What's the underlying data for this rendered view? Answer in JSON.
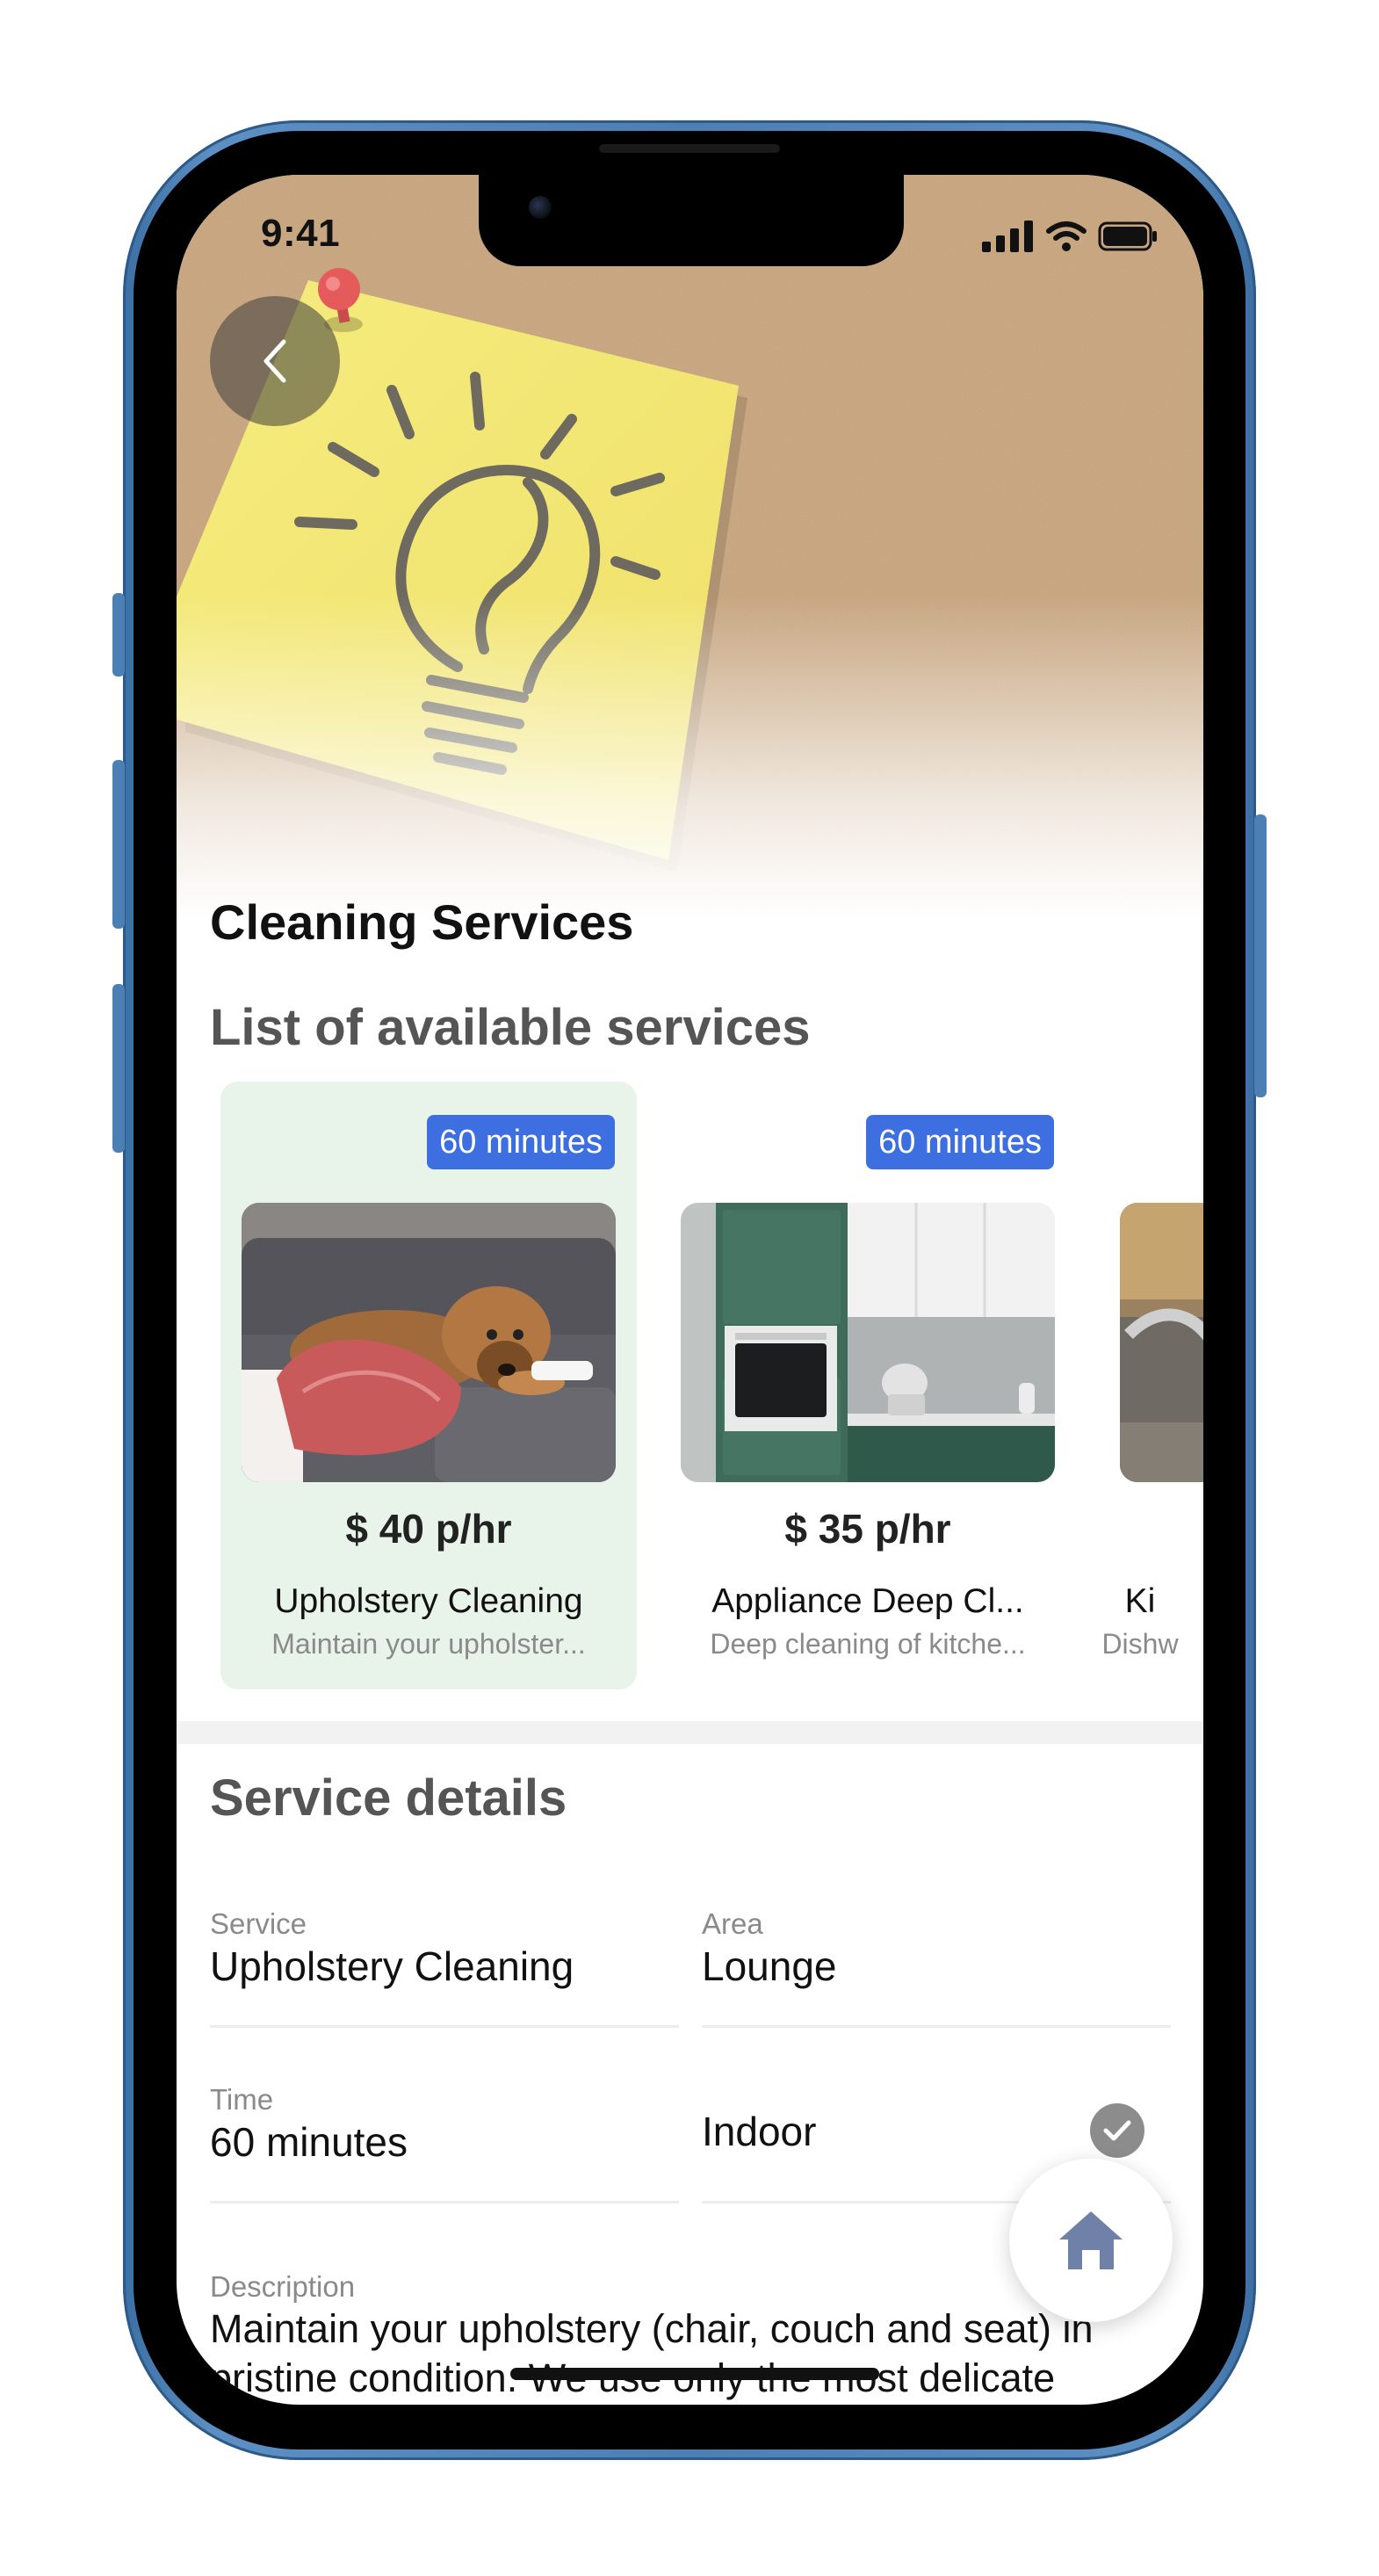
{
  "status_bar": {
    "time": "9:41"
  },
  "header": {
    "title": "Cleaning Services"
  },
  "services_list": {
    "heading": "List of available services",
    "cards": [
      {
        "duration": "60 minutes",
        "price": "$ 40 p/hr",
        "name": "Upholstery Cleaning",
        "description": "Maintain your upholster...",
        "image": "dog-on-sofa",
        "selected": true
      },
      {
        "duration": "60 minutes",
        "price": "$ 35 p/hr",
        "name": "Appliance Deep Cl...",
        "description": "Deep cleaning of kitche...",
        "image": "green-kitchen",
        "selected": false
      },
      {
        "duration": "",
        "price": "",
        "name": "Ki",
        "description": "Dishw",
        "image": "kitchen-sink",
        "selected": false
      }
    ]
  },
  "details": {
    "heading": "Service details",
    "service": {
      "label": "Service",
      "value": "Upholstery Cleaning"
    },
    "area": {
      "label": "Area",
      "value": "Lounge"
    },
    "time": {
      "label": "Time",
      "value": "60 minutes"
    },
    "indoor": {
      "value": "Indoor",
      "checked": true
    },
    "description": {
      "label": "Description",
      "value": "Maintain your upholstery (chair, couch and seat) in pristine condition. We use only the most delicate"
    }
  },
  "colors": {
    "badge": "#3d6fe0",
    "selected_card": "#e8f4ea",
    "frame": "#4c7fb4"
  },
  "icons": {
    "back": "chevron-left-icon",
    "home": "home-icon",
    "check": "check-icon"
  }
}
